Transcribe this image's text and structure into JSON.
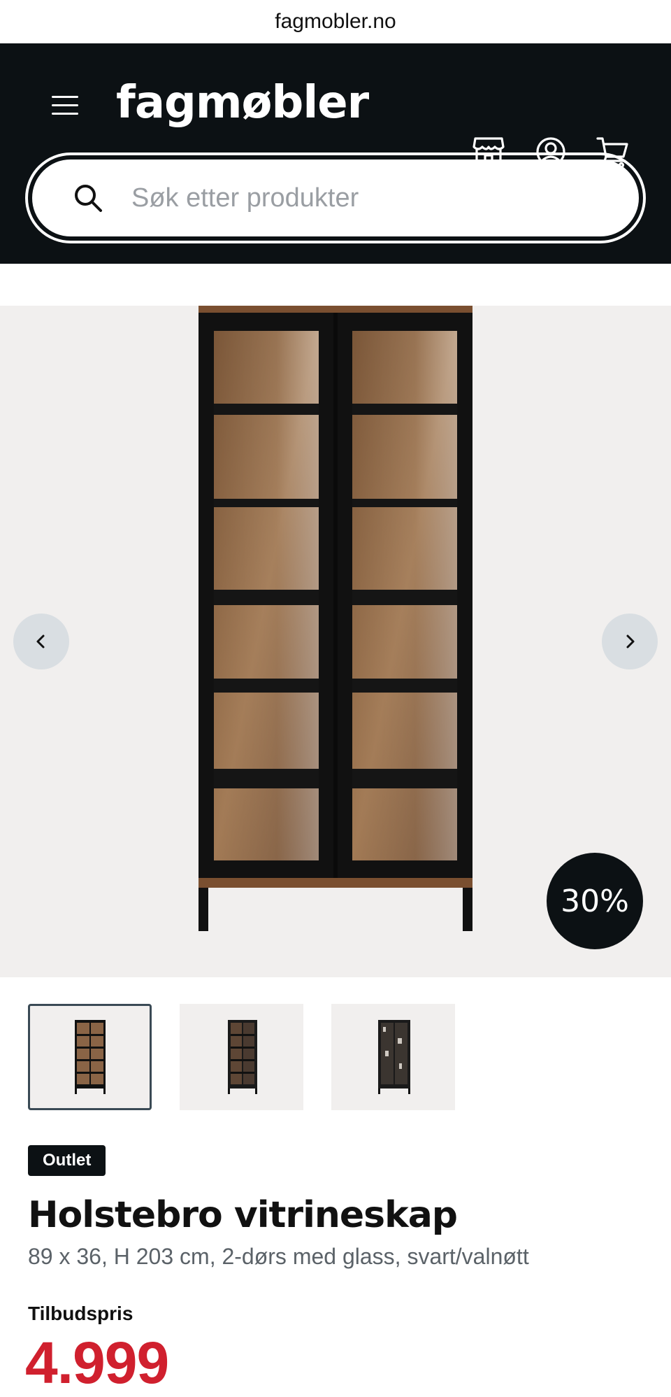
{
  "browser": {
    "url": "fagmobler.no"
  },
  "header": {
    "brand": "fagmøbler",
    "search_placeholder": "Søk etter produkter",
    "icons": [
      "menu-icon",
      "store-icon",
      "account-icon",
      "cart-icon"
    ]
  },
  "gallery": {
    "discount": "30%",
    "thumbnails": [
      "thumb-1",
      "thumb-2",
      "thumb-3"
    ],
    "active_index": 0
  },
  "product": {
    "badge": "Outlet",
    "title": "Holstebro vitrineskap",
    "subtitle": "89 x 36, H 203 cm, 2-dørs med glass, svart/valnøtt",
    "price_label": "Tilbudspris",
    "price": "4.999"
  },
  "colors": {
    "header_bg": "#0c1114",
    "price": "#d0202e",
    "gallery_bg": "#f1efee"
  }
}
